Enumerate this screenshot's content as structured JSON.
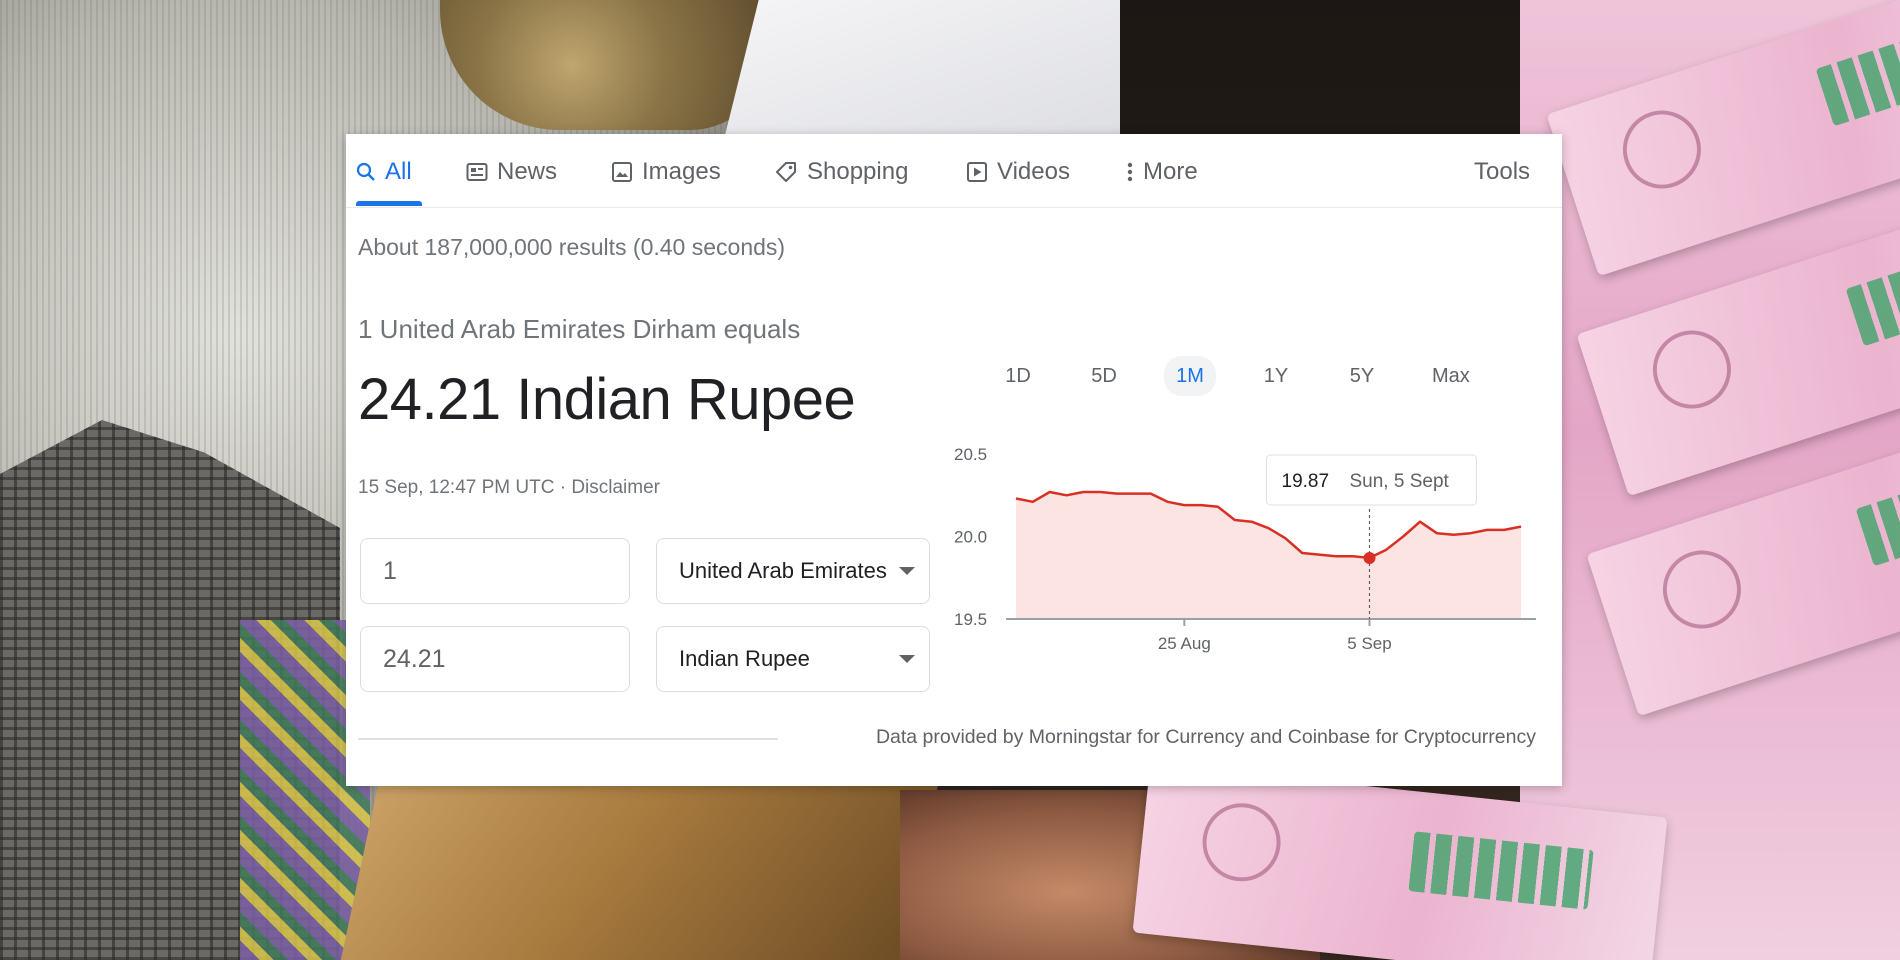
{
  "tabs": [
    {
      "label": "All",
      "icon": "search-icon",
      "active": true
    },
    {
      "label": "News",
      "icon": "news-icon"
    },
    {
      "label": "Images",
      "icon": "image-icon"
    },
    {
      "label": "Shopping",
      "icon": "tag-icon"
    },
    {
      "label": "Videos",
      "icon": "video-icon"
    },
    {
      "label": "More",
      "icon": "more-vert-icon"
    }
  ],
  "tools_label": "Tools",
  "result_stats": "About 187,000,000 results (0.40 seconds)",
  "converter": {
    "equals_text": "1 United Arab Emirates Dirham equals",
    "result_text": "24.21 Indian Rupee",
    "timestamp": "15 Sep, 12:47 PM UTC · ",
    "disclaimer": "Disclaimer",
    "from_amount": "1",
    "from_currency": "United Arab Emirates Dirham",
    "to_amount": "24.21",
    "to_currency": "Indian Rupee"
  },
  "ranges": [
    "1D",
    "5D",
    "1M",
    "1Y",
    "5Y",
    "Max"
  ],
  "active_range": "1M",
  "source_note": "Data provided by Morningstar for Currency and Coinbase for Cryptocurrency",
  "colors": {
    "accent": "#1a73e8",
    "line": "#d93025",
    "fill": "#fbe4e2"
  },
  "chart_data": {
    "type": "area",
    "ylim": [
      19.5,
      20.5
    ],
    "yticks": [
      "20.5",
      "20.0",
      "19.5"
    ],
    "xticks": [
      {
        "label": "25 Aug",
        "day": 10
      },
      {
        "label": "5 Sep",
        "day": 21
      }
    ],
    "x": [
      0,
      1,
      2,
      3,
      4,
      5,
      6,
      7,
      8,
      9,
      10,
      11,
      12,
      13,
      14,
      15,
      16,
      17,
      18,
      19,
      20,
      21,
      22,
      23,
      24,
      25,
      26,
      27,
      28,
      29,
      30
    ],
    "values": [
      20.23,
      20.21,
      20.27,
      20.25,
      20.27,
      20.27,
      20.26,
      20.26,
      20.26,
      20.21,
      20.19,
      20.19,
      20.18,
      20.1,
      20.09,
      20.05,
      19.99,
      19.9,
      19.89,
      19.88,
      19.88,
      19.87,
      19.92,
      20.0,
      20.09,
      20.02,
      20.01,
      20.02,
      20.04,
      20.04,
      20.06
    ],
    "highlight": {
      "index": 21,
      "value": "19.87",
      "date": "Sun, 5 Sept"
    }
  }
}
